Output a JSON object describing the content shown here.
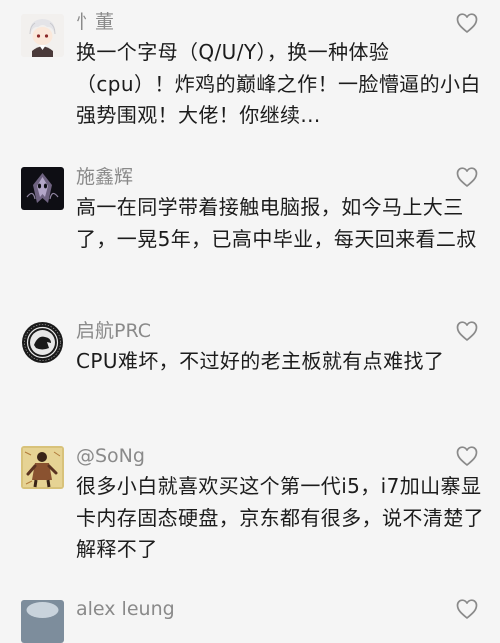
{
  "comments": [
    {
      "username": "忄董",
      "avatar_icon": "anime-character-avatar-icon",
      "text": "换一个字母（Q/U/Y），换一种体验（cpu）！炸鸡的巅峰之作！一脸懵逼的小白强势围观！大佬！你继续..."
    },
    {
      "username": "施鑫辉",
      "avatar_icon": "dark-mask-avatar-icon",
      "text": "高一在同学带着接触电脑报，如今马上大三了，一晃5年，已高中毕业，每天回来看二叔"
    },
    {
      "username": "启航PRC",
      "avatar_icon": "round-emblem-avatar-icon",
      "text": "CPU难坏，不过好的老主板就有点难找了"
    },
    {
      "username": "@SoNg",
      "avatar_icon": "illustrated-figure-avatar-icon",
      "text": "很多小白就喜欢买这个第一代i5，i7加山寨显卡内存固态硬盘，京东都有很多，说不清楚了解释不了"
    },
    {
      "username": "alex leung",
      "avatar_icon": "photo-avatar-icon",
      "text": ""
    }
  ],
  "like_icon": "heart-outline-icon"
}
